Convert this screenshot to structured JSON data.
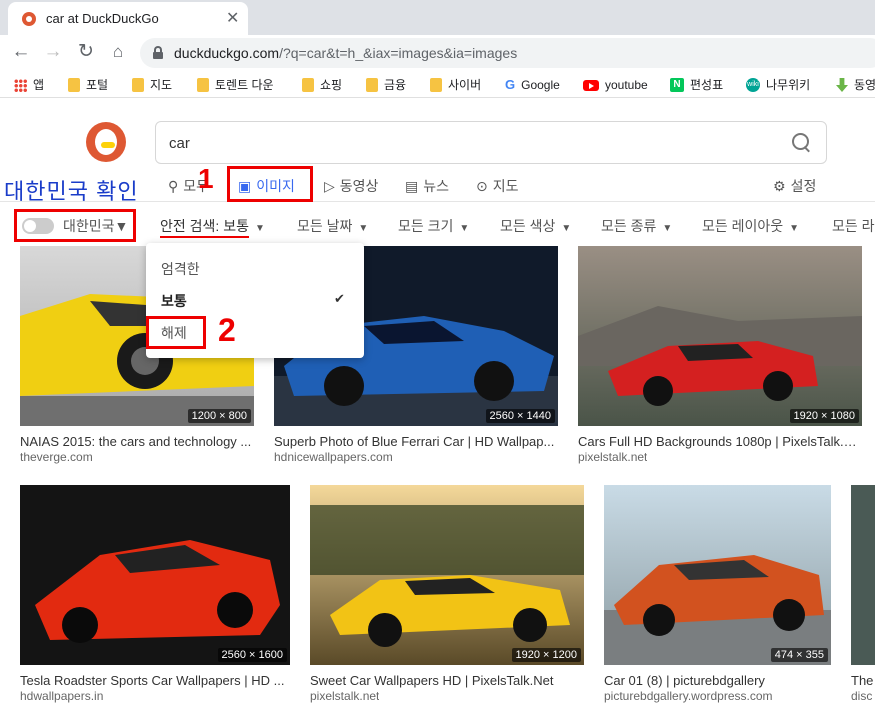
{
  "tab": {
    "title": "car at DuckDuckGo",
    "close": "✕"
  },
  "toolbar": {
    "url_host": "duckduckgo.com",
    "url_rest": "/?q=car&t=h_&iax=images&ia=images"
  },
  "bookmarks": [
    {
      "label": "앱",
      "icon": "apps-icon"
    },
    {
      "label": "포털",
      "icon": "folder-icon"
    },
    {
      "label": "지도",
      "icon": "folder-icon"
    },
    {
      "label": "토렌트 다운",
      "icon": "folder-icon"
    },
    {
      "label": "쇼핑",
      "icon": "folder-icon"
    },
    {
      "label": "금융",
      "icon": "folder-icon"
    },
    {
      "label": "사이버",
      "icon": "folder-icon"
    },
    {
      "label": "Google",
      "icon": "google-icon"
    },
    {
      "label": "youtube",
      "icon": "youtube-icon"
    },
    {
      "label": "편성표",
      "icon": "naver-icon"
    },
    {
      "label": "나무위키",
      "icon": "namuwiki-icon"
    },
    {
      "label": "동영",
      "icon": "download-icon"
    }
  ],
  "search": {
    "value": "car"
  },
  "annotations": {
    "korea_check": "대한민국 확인",
    "num1": "1",
    "num2": "2"
  },
  "nav": {
    "all": "모두",
    "images": "이미지",
    "videos": "동영상",
    "news": "뉴스",
    "maps": "지도",
    "settings": "설정"
  },
  "filters": {
    "region": "대한민국",
    "safe": "안전 검색: 보통",
    "date": "모든 날짜",
    "size": "모든 크기",
    "color": "모든 색상",
    "type": "모든 종류",
    "layout": "모든 레이아웃",
    "license": "모든 라"
  },
  "dropdown": {
    "strict": "엄격한",
    "moderate": "보통",
    "off": "해제",
    "check": "✔"
  },
  "results": [
    {
      "title": "NAIAS 2015: the cars and technology ...",
      "source": "theverge.com",
      "dims": "1200 × 800",
      "color": "yellow"
    },
    {
      "title": "Superb Photo of Blue Ferrari Car | HD Wallpap...",
      "source": "hdnicewallpapers.com",
      "dims": "2560 × 1440",
      "color": "blue"
    },
    {
      "title": "Cars Full HD Backgrounds 1080p | PixelsTalk.N...",
      "source": "pixelstalk.net",
      "dims": "1920 × 1080",
      "color": "red"
    },
    {
      "title": "Tesla Roadster Sports Car Wallpapers | HD ...",
      "source": "hdwallpapers.in",
      "dims": "2560 × 1600",
      "color": "red"
    },
    {
      "title": "Sweet Car Wallpapers HD | PixelsTalk.Net",
      "source": "pixelstalk.net",
      "dims": "1920 × 1200",
      "color": "yellow"
    },
    {
      "title": "Car 01 (8) | picturebdgallery",
      "source": "picturebdgallery.wordpress.com",
      "dims": "474 × 355",
      "color": "orange"
    },
    {
      "title": "The",
      "source": "disc",
      "dims": "",
      "color": "gray"
    }
  ]
}
